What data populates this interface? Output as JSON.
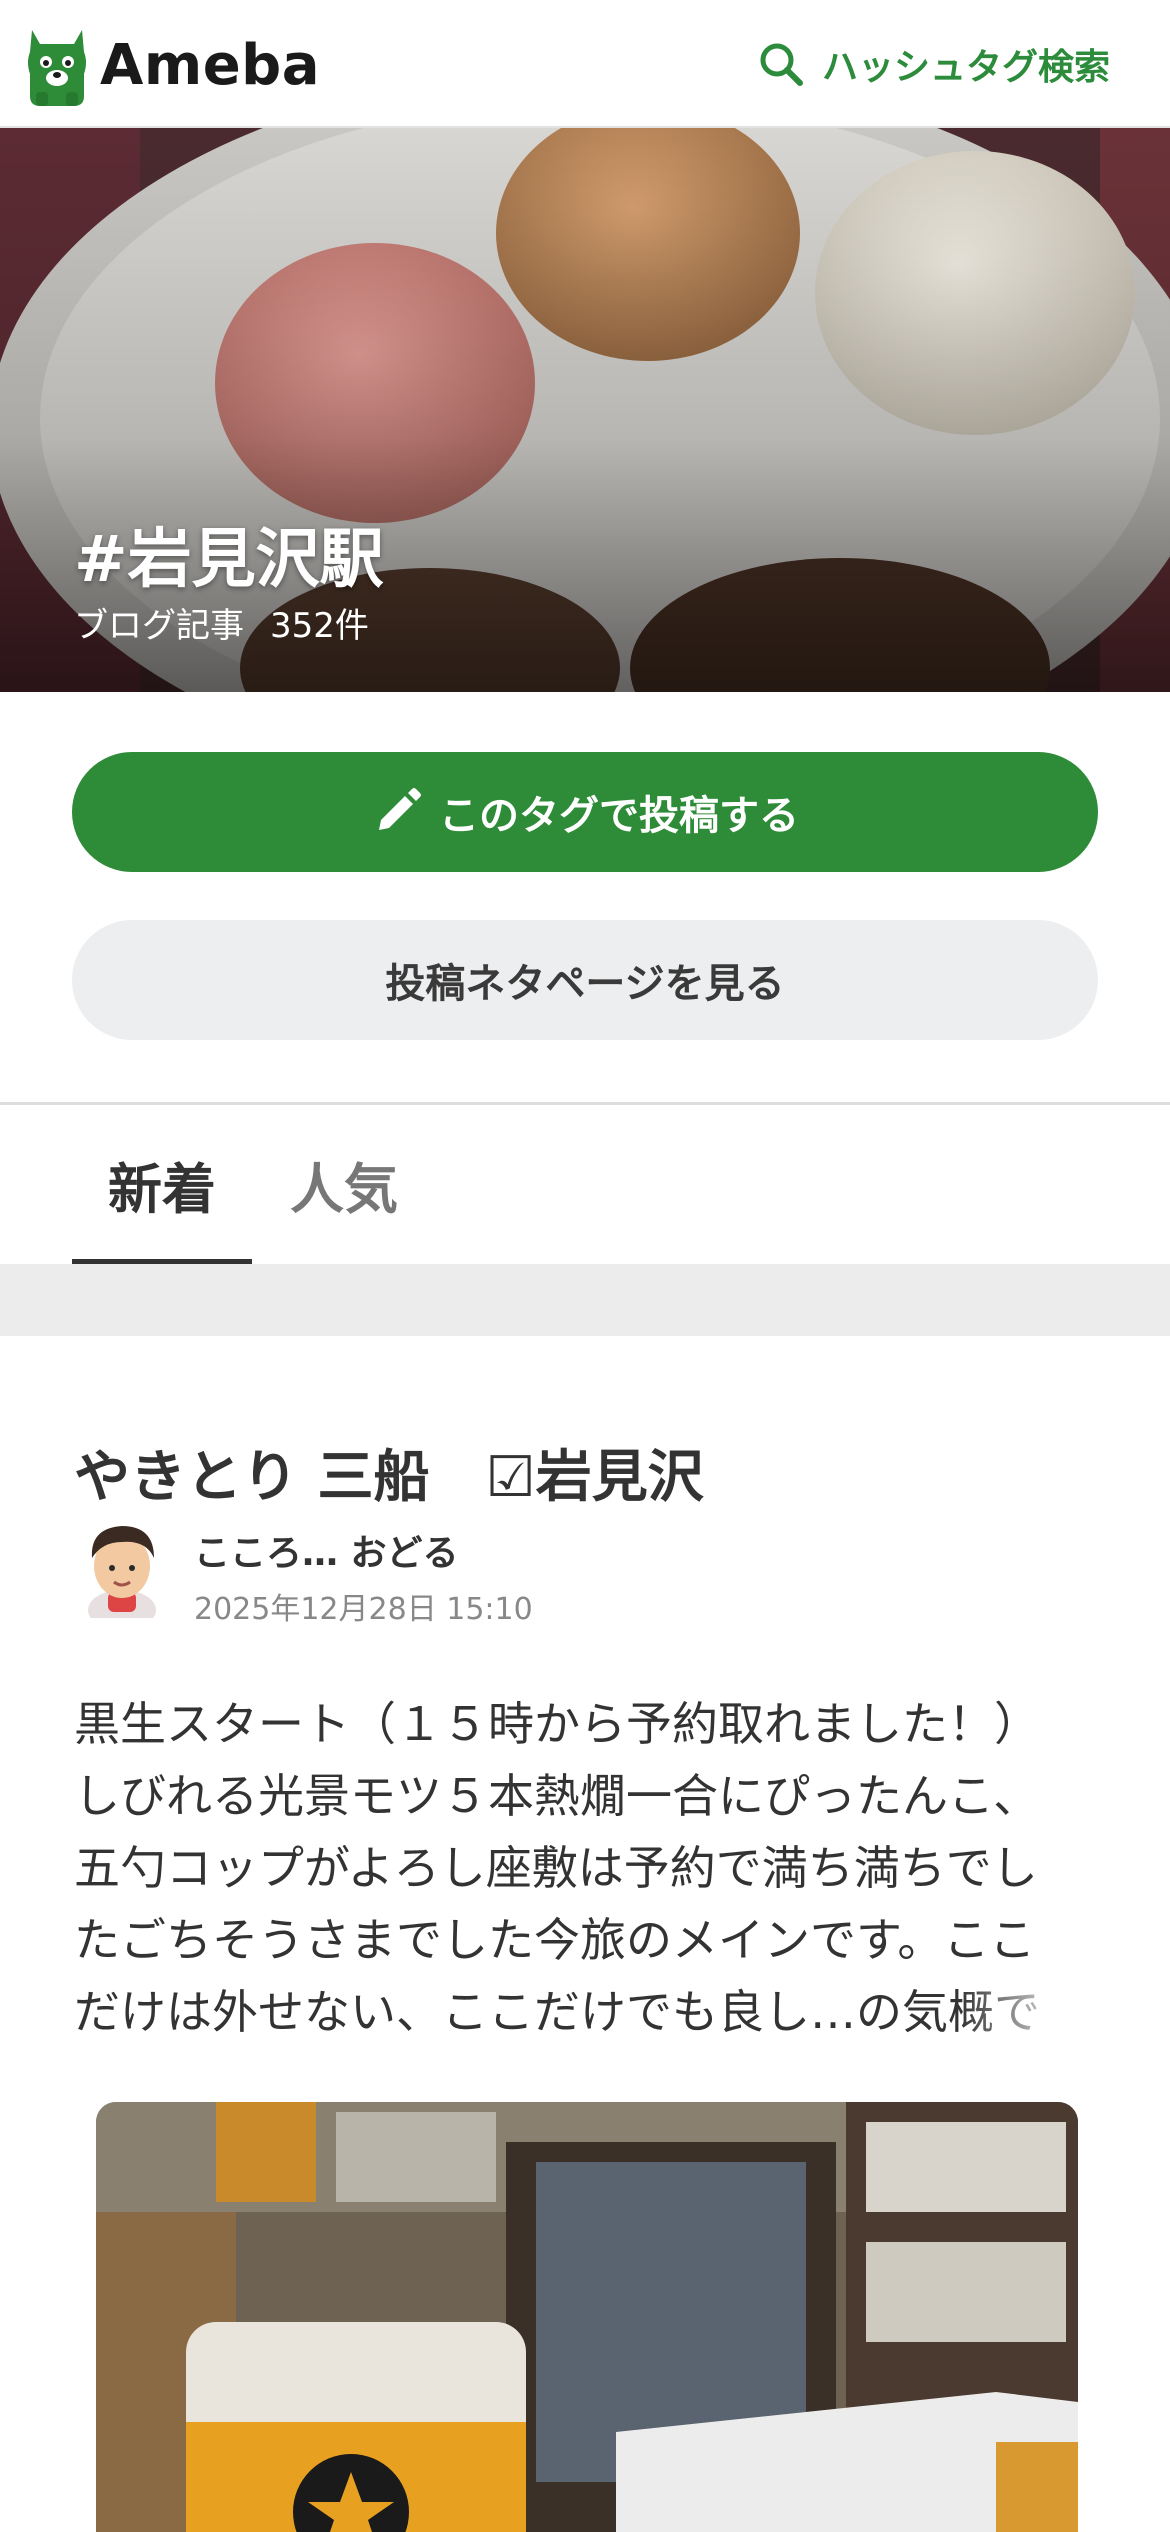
{
  "header": {
    "logo_text": "Ameba",
    "hashtag_search_label": "ハッシュタグ検索"
  },
  "hero": {
    "tag_title": "#岩見沢駅",
    "posts_label": "ブログ記事",
    "posts_count": "352件"
  },
  "actions": {
    "post_with_tag_label": "このタグで投稿する",
    "view_topics_label": "投稿ネタページを見る"
  },
  "tabs": [
    {
      "label": "新着",
      "active": true
    },
    {
      "label": "人気",
      "active": false
    }
  ],
  "article": {
    "title": "やきとり 三船　☑岩見沢",
    "author": "こころ… おどる",
    "date": "2025年12月28日 15:10",
    "body": "黒生スタート（１５時から予約取れました！）\nしびれる光景モツ５本熱燗一合にぴったんこ、\n五勺コップがよろし座敷は予約で満ち満ちでし\nたごちそうさまでした今旅のメインです。ここ\nだけは外せない、ここだけでも良し…の気概で"
  },
  "colors": {
    "brand_green": "#2e8b37",
    "search_green": "#2d8c3c",
    "secondary_button": "#eceeef",
    "divider_band": "#ececec"
  },
  "icons": {
    "logo": "ameba-logo-icon",
    "search": "search-icon",
    "pencil": "pencil-icon"
  }
}
